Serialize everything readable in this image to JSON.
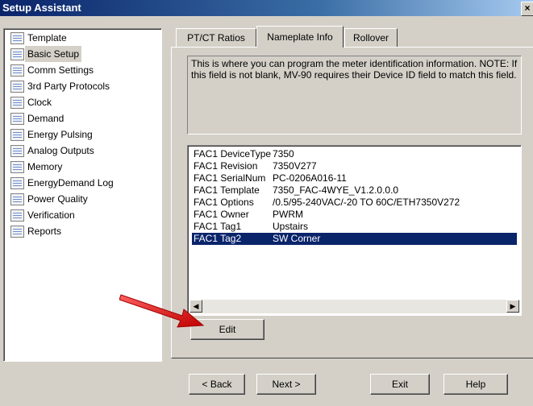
{
  "window": {
    "title": "Setup Assistant",
    "close_glyph": "×"
  },
  "sidebar": {
    "items": [
      {
        "label": "Template"
      },
      {
        "label": "Basic Setup"
      },
      {
        "label": "Comm Settings"
      },
      {
        "label": "3rd Party Protocols"
      },
      {
        "label": "Clock"
      },
      {
        "label": "Demand"
      },
      {
        "label": "Energy Pulsing"
      },
      {
        "label": "Analog Outputs"
      },
      {
        "label": "Memory"
      },
      {
        "label": "EnergyDemand Log"
      },
      {
        "label": "Power Quality"
      },
      {
        "label": "Verification"
      },
      {
        "label": "Reports"
      }
    ],
    "selected_index": 1
  },
  "tabs": [
    {
      "label": "PT/CT Ratios"
    },
    {
      "label": "Nameplate Info"
    },
    {
      "label": "Rollover"
    }
  ],
  "active_tab": "Nameplate Info",
  "info_text": "This is where you can program the meter identification information. NOTE: If this field is not blank, MV-90 requires their Device ID field to match this field.",
  "nameplate": {
    "rows": [
      {
        "key": "FAC1 DeviceType",
        "value": "7350"
      },
      {
        "key": "FAC1 Revision",
        "value": "7350V277"
      },
      {
        "key": "FAC1 SerialNum",
        "value": "PC-0206A016-11"
      },
      {
        "key": "FAC1 Template",
        "value": "7350_FAC-4WYE_V1.2.0.0.0"
      },
      {
        "key": "FAC1 Options",
        "value": "/0.5/95-240VAC/-20 TO 60C/ETH7350V272"
      },
      {
        "key": "FAC1 Owner",
        "value": "PWRM"
      },
      {
        "key": "FAC1 Tag1",
        "value": "Upstairs"
      },
      {
        "key": "FAC1 Tag2",
        "value": "SW Corner"
      }
    ],
    "selected_index": 7
  },
  "buttons": {
    "edit": "Edit",
    "back": "< Back",
    "next": "Next >",
    "exit": "Exit",
    "help": "Help"
  },
  "colors": {
    "selection": "#0a246a",
    "annotation_arrow": "#e02020"
  },
  "icons": {
    "nav_item": "document-icon",
    "annotation": "red-arrow"
  }
}
